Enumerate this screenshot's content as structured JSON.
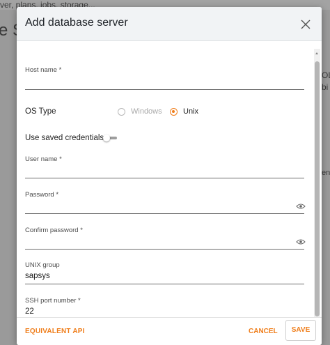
{
  "background": {
    "top_text": "ver, plans, jobs, storage...",
    "title_fragment": "e S",
    "right_text_1": "OL",
    "right_text_2": "bi",
    "right_text_3": "en"
  },
  "dialog": {
    "title": "Add database server",
    "close_icon": "close-icon",
    "fields": {
      "host_name": {
        "label": "Host name *",
        "value": ""
      },
      "os_type": {
        "label": "OS Type",
        "options": [
          {
            "label": "Windows",
            "selected": false,
            "disabled": true
          },
          {
            "label": "Unix",
            "selected": true,
            "disabled": false
          }
        ]
      },
      "saved_credentials": {
        "label": "Use saved credentials",
        "enabled": false
      },
      "user_name": {
        "label": "User name *",
        "value": ""
      },
      "password": {
        "label": "Password *",
        "value": "",
        "icon": "eye-icon"
      },
      "confirm_password": {
        "label": "Confirm password *",
        "value": "",
        "icon": "eye-icon"
      },
      "unix_group": {
        "label": "UNIX group",
        "value": "sapsys"
      },
      "ssh_port": {
        "label": "SSH port number *",
        "value": "22"
      }
    },
    "footer": {
      "equivalent_api": "EQUIVALENT API",
      "cancel": "CANCEL",
      "save": "SAVE"
    }
  },
  "colors": {
    "accent": "#ef7d1a",
    "header_bg": "#f1f3f5",
    "overlay": "#9a9a9a"
  }
}
